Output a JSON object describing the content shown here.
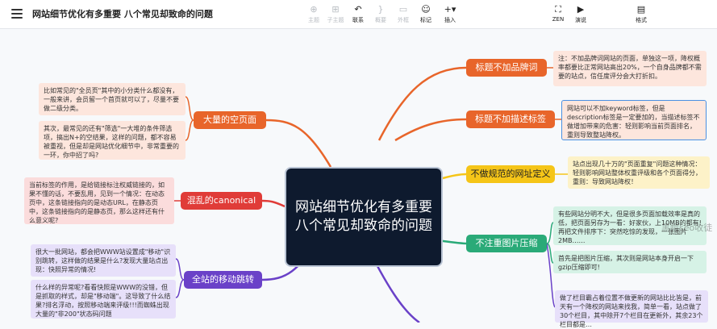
{
  "toolbar": {
    "title": "网站细节优化有多重要 八个常见却致命的问题",
    "tools": [
      {
        "label": "主题",
        "icon": "node-icon",
        "glyph": "⊕"
      },
      {
        "label": "子主题",
        "icon": "subnode-icon",
        "glyph": "⊞"
      },
      {
        "label": "联系",
        "icon": "relation-icon",
        "glyph": "↶"
      },
      {
        "label": "概要",
        "icon": "summary-icon",
        "glyph": "}"
      },
      {
        "label": "外框",
        "icon": "boundary-icon",
        "glyph": "▭"
      },
      {
        "label": "标记",
        "icon": "marker-icon",
        "glyph": "☺"
      },
      {
        "label": "插入",
        "icon": "insert-icon",
        "glyph": "+▾"
      },
      {
        "label": "ZEN",
        "icon": "zen-icon",
        "glyph": "⛶"
      },
      {
        "label": "演说",
        "icon": "pitch-icon",
        "glyph": "▶"
      },
      {
        "label": "格式",
        "icon": "format-icon",
        "glyph": "▤"
      }
    ]
  },
  "map": {
    "central": "网站细节优化有多重要 八个常见却致命的问题",
    "topics": {
      "title_brand": "标题不加品牌词",
      "title_desc": "标题不加描述标签",
      "url": "不做规范的网址定义",
      "images": "不注重图片压缩",
      "space": "大量的空页面",
      "canonical": "混乱的canonical",
      "mobile": "全站的移动跳转"
    },
    "notes": {
      "brand": "注：不加品牌词网站的页面，单独这一项，降权概率都要比正常网站高出20%，一个自身品牌都不需要的站点，信任度评分会大打折扣。",
      "desc": "网站可以不加keyword标签，但是description标签是一定要加的，当描述标签不做增加带来的危害：轻则影响当前页面排名，重则导致整站降权。",
      "url": "站点出现几十万的\"页面重复\"问题这种情况：轻则影响网站整体权重评级和各个页面得分，重则：导致网站降权！",
      "img1": "有些网站分明不大，但是很多页面加载效率是真的低，把页面另存为一看：好家伙，上10MB的都有!再把文件排序下：突然吃惊的发现，一张图片2MB……",
      "img2": "首先是把图片压缩，其次则是网站本身开启一下gzip压缩即可!",
      "img3": "做了栏目霸占着位置不做更新的网站比比皆是，前天有一个降权的网站来找我，简单一看，站点做了30个栏目，其中除开7个栏目在更新外，其余23个栏目都是…",
      "space1": "比如常见的\"全员页\"其中的小分类什么都没有，一般来讲，会员留一个首页就可以了，尽量不要做二级分类。",
      "space2": "其次，最常见的还有\"筛选\"一大堆的条件筛选项，搞出N+的空结果，这样的问题，都不容易被重视，但是却是网站优化细节中，非常重要的一环，你中招了吗?",
      "canonical": "当前标签的作用，是给链接标注权威链接的，如果不懂的话，不要乱用，见到一个情况：在动态页中，这条链接指向的是动态URL，在静态页中，这条链接指向的是静态页，那么这样还有什么意义呢?",
      "mobile1": "很大一批网站，都会把WWW站设置成\"移动\"识别跳转，这样做的结果是什么?发现大量站点出现：快照异常的情况!",
      "mobile2": "什么样的异常呢?看看快照是WWW的没错，但是抓取的样式，却是\"移动端\"。这导致了什么结果?排名浮动，按照移动端来评级!!!而蜘蛛出现大量的\"非200\"状态码问题"
    },
    "watermark": "黑帽seo收徒"
  },
  "colors": {
    "central_bg": "#0e1a2e",
    "topic_orange": "#e8652a",
    "topic_yellow": "#f5c518",
    "topic_green": "#2aaa78",
    "topic_red": "#e03c38",
    "topic_purple": "#6a41c8"
  }
}
